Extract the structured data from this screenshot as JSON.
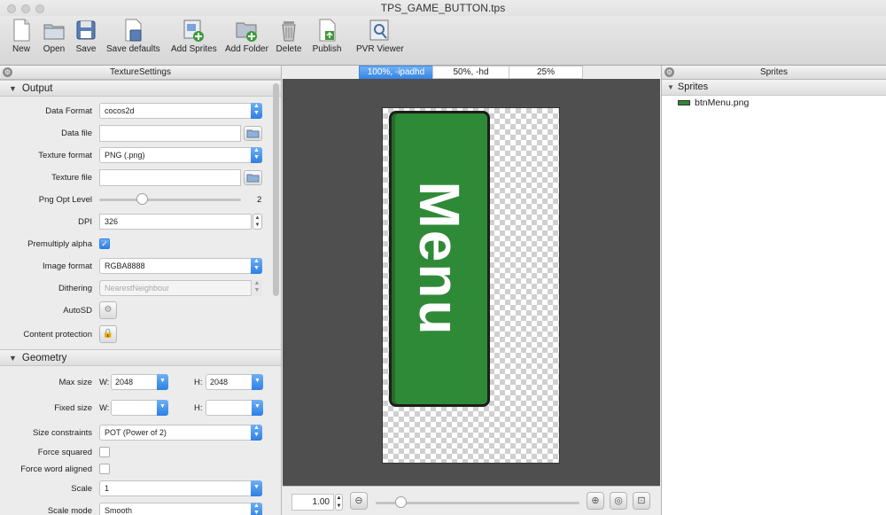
{
  "window": {
    "title": "TPS_GAME_BUTTON.tps"
  },
  "toolbar": {
    "items": [
      {
        "label": "New",
        "icon": "new-document-icon"
      },
      {
        "label": "Open",
        "icon": "open-folder-icon"
      },
      {
        "label": "Save",
        "icon": "save-disk-icon"
      },
      {
        "label": "Save defaults",
        "icon": "save-defaults-icon"
      },
      {
        "label": "Add Sprites",
        "icon": "add-sprites-icon"
      },
      {
        "label": "Add Folder",
        "icon": "add-folder-icon"
      },
      {
        "label": "Delete",
        "icon": "trash-icon"
      },
      {
        "label": "Publish",
        "icon": "publish-icon"
      },
      {
        "label": "PVR Viewer",
        "icon": "pvr-viewer-icon"
      }
    ]
  },
  "left_panel": {
    "title": "TextureSettings",
    "output": {
      "section": "Output",
      "data_format": {
        "label": "Data Format",
        "value": "cocos2d"
      },
      "data_file": {
        "label": "Data file",
        "value": ""
      },
      "texture_format": {
        "label": "Texture format",
        "value": "PNG (.png)"
      },
      "texture_file": {
        "label": "Texture file",
        "value": ""
      },
      "png_opt": {
        "label": "Png Opt Level",
        "value": "2",
        "fraction": 0.3
      },
      "dpi": {
        "label": "DPI",
        "value": "326"
      },
      "premultiply": {
        "label": "Premultiply alpha",
        "checked": true
      },
      "image_format": {
        "label": "Image format",
        "value": "RGBA8888"
      },
      "dithering": {
        "label": "Dithering",
        "value": "NearestNeighbour"
      },
      "autosd": {
        "label": "AutoSD"
      },
      "content_protection": {
        "label": "Content protection"
      }
    },
    "geometry": {
      "section": "Geometry",
      "max_size": {
        "label": "Max size",
        "w_label": "W:",
        "w": "2048",
        "h_label": "H:",
        "h": "2048"
      },
      "fixed_size": {
        "label": "Fixed size",
        "w_label": "W:",
        "w": "",
        "h_label": "H:",
        "h": ""
      },
      "size_constraints": {
        "label": "Size constraints",
        "value": "POT (Power of 2)"
      },
      "force_squared": {
        "label": "Force squared",
        "checked": false
      },
      "force_word_aligned": {
        "label": "Force word aligned",
        "checked": false
      },
      "scale": {
        "label": "Scale",
        "value": "1"
      },
      "scale_mode": {
        "label": "Scale mode",
        "value": "Smooth"
      }
    }
  },
  "center": {
    "tabs": [
      "100%, -ipadhd",
      "50%, -hd",
      "25%"
    ],
    "active_tab": 0,
    "sprite_text": "Menu",
    "zoom": {
      "value": "1.00",
      "fraction": 0.12
    }
  },
  "right_panel": {
    "title": "Sprites",
    "group": "Sprites",
    "items": [
      "btnMenu.png"
    ]
  },
  "colors": {
    "accent": "#3a86e5",
    "sprite_green": "#2f8a37",
    "canvas_bg": "#4f4f4f"
  }
}
